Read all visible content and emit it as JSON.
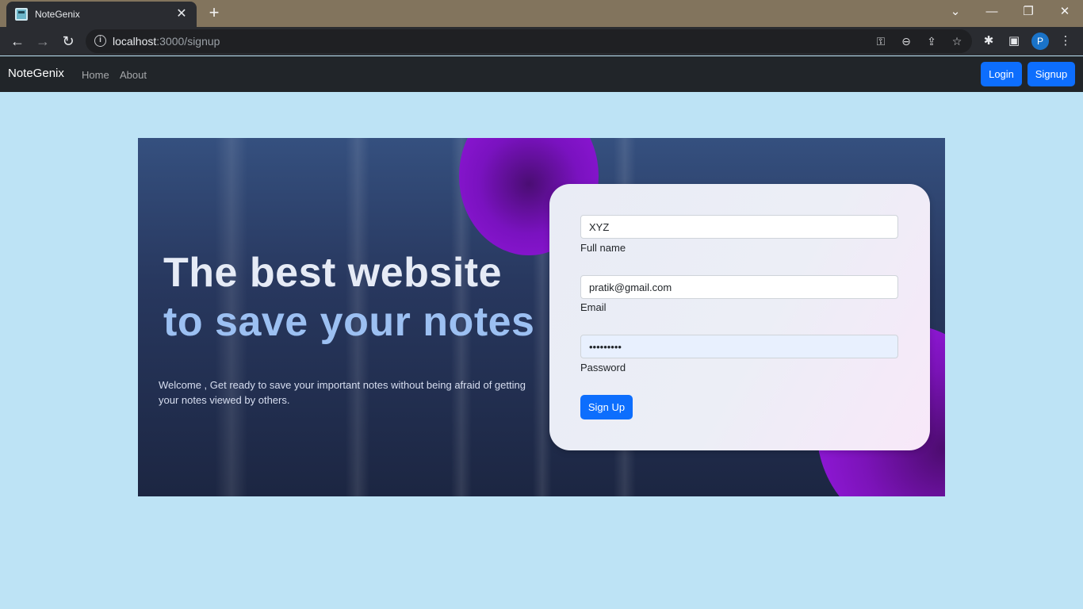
{
  "browser": {
    "tab_title": "NoteGenix",
    "url_host": "localhost",
    "url_path": ":3000/signup",
    "profile_initial": "P"
  },
  "navbar": {
    "brand": "NoteGenix",
    "links": [
      "Home",
      "About"
    ],
    "login_label": "Login",
    "signup_label": "Signup"
  },
  "hero": {
    "headline_line1": "The best website",
    "headline_line2": "to save your notes",
    "welcome_text": "Welcome , Get ready to save your important notes without being afraid of getting your notes viewed by others."
  },
  "form": {
    "fullname_value": "XYZ",
    "fullname_label": "Full name",
    "email_value": "pratik@gmail.com",
    "email_label": "Email",
    "password_mask": "•••••••••",
    "password_label": "Password",
    "submit_label": "Sign Up"
  },
  "colors": {
    "page_bg": "#bde3f5",
    "navbar_bg": "#212529",
    "primary": "#0d6efd",
    "hero_dark": "#1c2642",
    "orb_purple": "#9818e0",
    "headline_accent": "#9cc0f2"
  },
  "icons": {
    "tab_close": "✕",
    "new_tab": "+",
    "back": "←",
    "forward": "→",
    "reload": "↻",
    "key": "⚿",
    "zoom": "⊖",
    "share": "⇪",
    "star": "☆",
    "extensions": "✱",
    "sidepanel": "▣",
    "menu": "⋮",
    "tab_search": "⌄",
    "minimize": "—",
    "restore": "❐",
    "close": "✕"
  }
}
